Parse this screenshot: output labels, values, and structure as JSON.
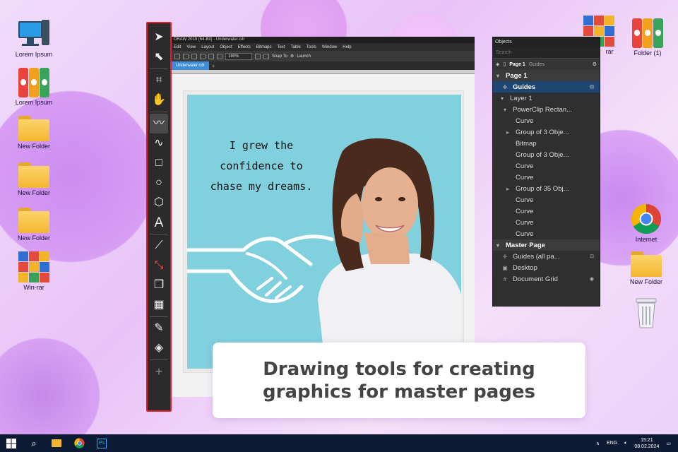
{
  "desktop": {
    "left_icons": [
      {
        "label": "Lorem Ipsum",
        "icon": "computer-icon"
      },
      {
        "label": "Lorem Ipsum",
        "icon": "binders-icon"
      },
      {
        "label": "New Folder",
        "icon": "folder-icon"
      },
      {
        "label": "New Folder",
        "icon": "folder-icon"
      },
      {
        "label": "New Folder",
        "icon": "folder-icon"
      },
      {
        "label": "Win-rar",
        "icon": "winrar-icon"
      }
    ],
    "right_icons": [
      {
        "label": "rar",
        "icon": "winrar-icon"
      },
      {
        "label": "Folder (1)",
        "icon": "binders-icon"
      },
      {
        "label": "Internet",
        "icon": "chrome-icon"
      },
      {
        "label": "New Folder",
        "icon": "folder-icon"
      },
      {
        "label": "",
        "icon": "recycle-bin-icon"
      }
    ]
  },
  "app": {
    "title": "DRAW 2019 (64-Bit) - Underwater.cdr",
    "menu": [
      "Edit",
      "View",
      "Layout",
      "Object",
      "Effects",
      "Bitmaps",
      "Text",
      "Table",
      "Tools",
      "Window",
      "Help"
    ],
    "zoom": "180%",
    "snap": "Snap To",
    "launch": "Launch",
    "doc_tab": "Underwater.cdr",
    "artwork_quote": "I grew the confidence to chase my dreams."
  },
  "toolbox": {
    "tools": [
      "pick-tool-icon",
      "shape-tool-icon",
      "crop-tool-icon",
      "pan-tool-icon",
      "freehand-tool-icon",
      "artistic-media-icon",
      "rectangle-tool-icon",
      "ellipse-tool-icon",
      "polygon-tool-icon",
      "text-tool-icon",
      "dimension-tool-icon",
      "connector-tool-icon",
      "drop-shadow-icon",
      "transparency-icon",
      "eyedropper-icon",
      "fill-icon",
      "add-tool-icon"
    ]
  },
  "objects_panel": {
    "title": "Objects",
    "search_placeholder": "Search",
    "page_label": "Page 1",
    "guides_label": "Guides",
    "rows": [
      {
        "label": "Page 1",
        "type": "section"
      },
      {
        "label": "Guides",
        "type": "sel"
      },
      {
        "label": "Layer 1",
        "indent": 1
      },
      {
        "label": "PowerClip Rectan...",
        "indent": 2
      },
      {
        "label": "Curve",
        "indent": 3
      },
      {
        "label": "Group of 3 Obje...",
        "indent": 3
      },
      {
        "label": "Bitmap",
        "indent": 3
      },
      {
        "label": "Group of 3 Obje...",
        "indent": 3
      },
      {
        "label": "Curve",
        "indent": 3
      },
      {
        "label": "Curve",
        "indent": 3
      },
      {
        "label": "Group of 35 Obj...",
        "indent": 3
      },
      {
        "label": "Curve",
        "indent": 3
      },
      {
        "label": "Curve",
        "indent": 3
      },
      {
        "label": "Curve",
        "indent": 3
      },
      {
        "label": "Curve",
        "indent": 3
      },
      {
        "label": "Master Page",
        "type": "section"
      },
      {
        "label": "Guides (all pa...",
        "indent": 1
      },
      {
        "label": "Desktop",
        "indent": 1
      },
      {
        "label": "Document Grid",
        "indent": 1
      }
    ]
  },
  "caption": {
    "line1": "Drawing tools for creating",
    "line2": "graphics for master pages"
  },
  "taskbar": {
    "lang": "ENG",
    "time": "15:21",
    "date": "08.02.2024",
    "ps_label": "Ps"
  },
  "colors": {
    "accent_red": "#e41e2a",
    "selection": "#1e4672",
    "artwork_bg": "#80d0de"
  }
}
